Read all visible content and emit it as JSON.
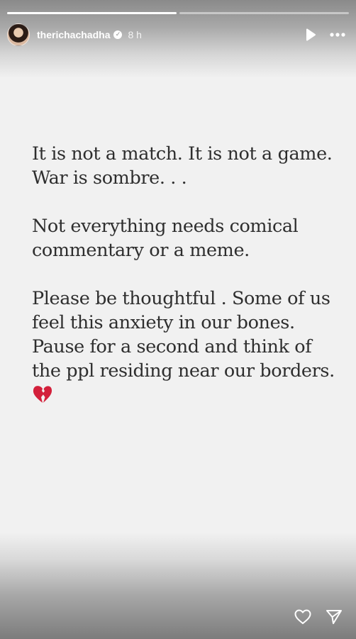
{
  "story": {
    "progress": [
      1.0,
      0.0
    ]
  },
  "header": {
    "username": "therichachadha",
    "time": "8 h",
    "avatar_icon": "profile-photo",
    "verified_icon": "verified-badge-icon",
    "play_icon": "play-icon",
    "more_icon": "more-dots-icon"
  },
  "message": {
    "paragraph_1": "It is not a match. It is not a game.\nWar is sombre. . .",
    "paragraph_2": "Not everything needs comical\ncommentary or a meme.",
    "paragraph_3": "Please be thoughtful . Some of us\nfeel this anxiety in our bones.\nPause for a second and think of\nthe ppl residing near our borders.",
    "emoji": "broken-heart-icon"
  },
  "footer": {
    "like_icon": "heart-icon",
    "share_icon": "send-icon"
  },
  "colors": {
    "background": "#f1f1f1",
    "text": "#2e2e2e",
    "emoji": "#d3203b"
  }
}
